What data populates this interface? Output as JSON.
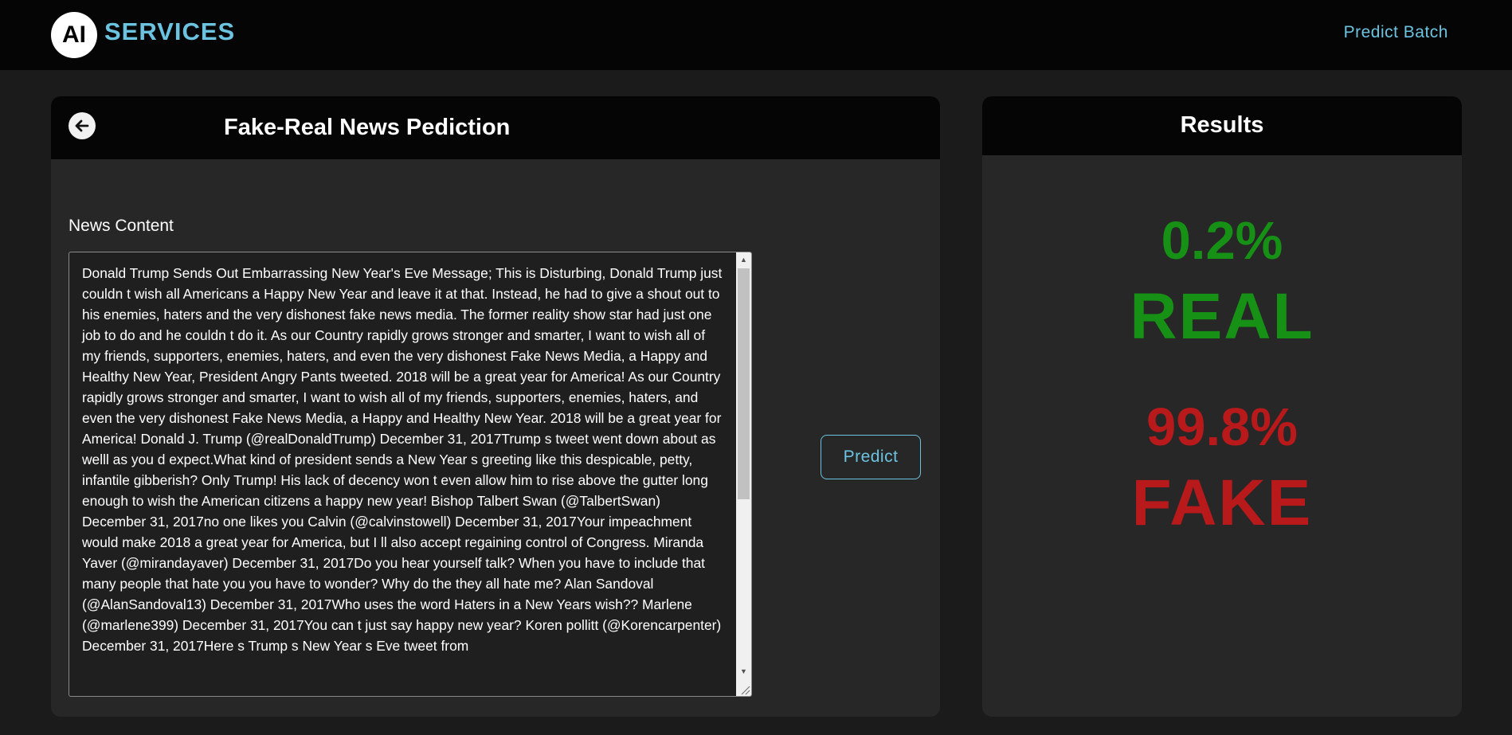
{
  "navbar": {
    "logo_mark": "AI",
    "brand": "SERVICES",
    "link_predict_batch": "Predict Batch"
  },
  "left_panel": {
    "title": "Fake-Real News Pediction",
    "field_label": "News Content",
    "news_content": "Donald Trump Sends Out Embarrassing New Year's Eve Message; This is Disturbing, Donald Trump just couldn t wish all Americans a Happy New Year and leave it at that. Instead, he had to give a shout out to his enemies, haters and  the very dishonest fake news media.  The former reality show star had just one job to do and he couldn t do it. As our Country rapidly grows stronger and smarter, I want to wish all of my friends, supporters, enemies, haters, and even the very dishonest Fake News Media, a Happy and Healthy New Year,  President Angry Pants tweeted.  2018 will be a great year for America! As our Country rapidly grows stronger and smarter, I want to wish all of my friends, supporters, enemies, haters, and even the very dishonest Fake News Media, a Happy and Healthy New Year. 2018 will be a great year for America!  Donald J. Trump (@realDonaldTrump) December 31, 2017Trump s tweet went down about as welll as you d expect.What kind of president sends a New Year s greeting like this despicable, petty, infantile gibberish? Only Trump! His lack of decency won t even allow him to rise above the gutter long enough to wish the American citizens a happy new year!  Bishop Talbert Swan (@TalbertSwan) December 31, 2017no one likes you  Calvin (@calvinstowell) December 31, 2017Your impeachment would make 2018 a great year for America, but I ll also accept regaining control of Congress.  Miranda Yaver (@mirandayaver) December 31, 2017Do you hear yourself talk? When you have to include that many people that hate you you have to wonder? Why do the they all hate me?  Alan Sandoval (@AlanSandoval13) December 31, 2017Who uses the word Haters in a New Years wish??  Marlene (@marlene399) December 31, 2017You can t just say happy new year?  Koren pollitt (@Korencarpenter) December 31, 2017Here s Trump s New Year s Eve tweet from",
    "predict_label": "Predict"
  },
  "results": {
    "title": "Results",
    "real_percent": "0.2%",
    "real_label": "REAL",
    "fake_percent": "99.8%",
    "fake_label": "FAKE"
  },
  "colors": {
    "accent": "#6cc3e0",
    "real": "#169116",
    "fake": "#b8191a"
  }
}
